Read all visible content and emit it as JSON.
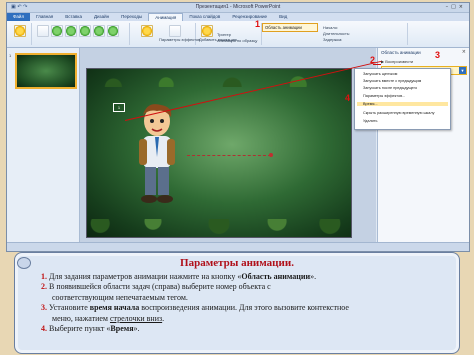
{
  "window": {
    "title": "Презентация1 - Microsoft PowerPoint"
  },
  "ribbon": {
    "tabs": [
      "Файл",
      "Главная",
      "Вставка",
      "Дизайн",
      "Переходы",
      "Анимация",
      "Показ слайдов",
      "Рецензирование",
      "Вид"
    ],
    "active_tab": "Анимация",
    "buttons": {
      "animation_pane": "Область анимации",
      "trigger": "Триггер",
      "painter": "Анимация по образцу",
      "start": "Начало:",
      "duration": "Длительность:",
      "delay": "Задержка:",
      "effect_params": "Параметры эффектов",
      "add_animation": "Добавить анимацию"
    }
  },
  "slides_pane": {
    "slide_number": "1"
  },
  "slide": {
    "selection_label": "1"
  },
  "task_pane": {
    "title": "Область анимации",
    "play": "▶ Воспроизвести",
    "item": "1 ☆ Группа 8"
  },
  "context_menu": {
    "items": [
      "Запускать щелчком",
      "Запускать вместе с предыдущим",
      "Запускать после предыдущего",
      "Параметры эффектов...",
      "Время...",
      "Скрыть расширенную временную шкалу",
      "Удалить"
    ]
  },
  "markers": [
    "1",
    "2",
    "3",
    "4"
  ],
  "instructions": {
    "title": "Параметры анимации.",
    "steps": [
      {
        "num": "1.",
        "text_a": "Для задания параметров анимации нажмите на кнопку «",
        "bold": "Область анимации",
        "text_b": "»."
      },
      {
        "num": "2.",
        "text_a": "В появившейся области задач (справа) выберите номер объекта с",
        "cont": "соответствующим непечатаемым тегом."
      },
      {
        "num": "3.",
        "text_a": "Установите ",
        "bold": "время начала",
        "text_b": " воспроизведения анимации. Для этого вызовите контекстное",
        "cont_a": "меню, нажатием ",
        "underline": "стрелочки вниз",
        "cont_b": "."
      },
      {
        "num": "4.",
        "text_a": "Выберите пункт «",
        "bold": "Время",
        "text_b": "»."
      }
    ]
  }
}
